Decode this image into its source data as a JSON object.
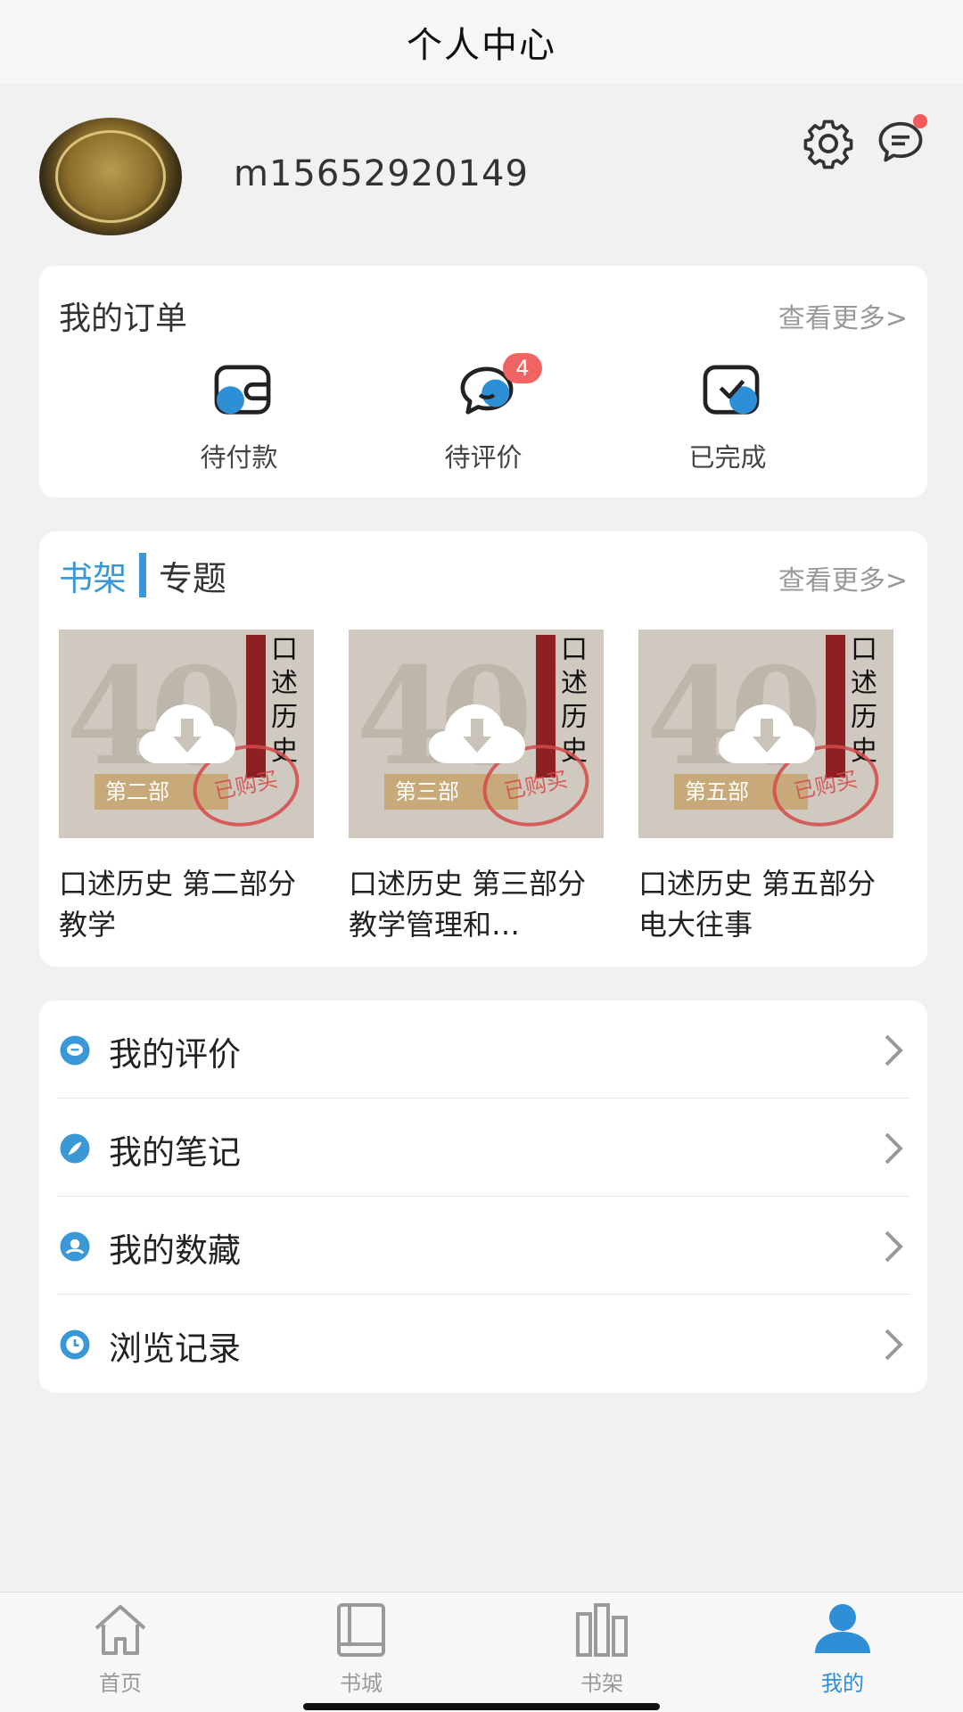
{
  "header": {
    "title": "个人中心"
  },
  "profile": {
    "username": "m15652920149",
    "settings_icon": "gear-icon",
    "messages_icon": "chat-icon"
  },
  "orders": {
    "title": "我的订单",
    "more": "查看更多>",
    "items": [
      {
        "label": "待付款",
        "icon": "wallet-icon"
      },
      {
        "label": "待评价",
        "icon": "comment-icon",
        "badge": "4"
      },
      {
        "label": "已完成",
        "icon": "check-icon"
      }
    ]
  },
  "shelf": {
    "tab_active": "书架",
    "tab_other": "专题",
    "more": "查看更多>",
    "books": [
      {
        "title": "口述历史 第二部分 教学",
        "cover_part": "第二部",
        "cover_title": "口述历史",
        "cover_stamp": "已购买"
      },
      {
        "title": "口述历史 第三部分 教学管理和…",
        "cover_part": "第三部",
        "cover_title": "口述历史",
        "cover_stamp": "已购买"
      },
      {
        "title": "口述历史 第五部分 电大往事",
        "cover_part": "第五部",
        "cover_title": "口述历史",
        "cover_stamp": "已购买"
      }
    ]
  },
  "menu": {
    "items": [
      {
        "label": "我的评价",
        "icon": "comment-circle-icon"
      },
      {
        "label": "我的笔记",
        "icon": "feather-icon"
      },
      {
        "label": "我的数藏",
        "icon": "collection-icon"
      },
      {
        "label": "浏览记录",
        "icon": "clock-icon"
      }
    ]
  },
  "tabbar": {
    "items": [
      {
        "label": "首页",
        "icon": "home-icon"
      },
      {
        "label": "书城",
        "icon": "book-icon"
      },
      {
        "label": "书架",
        "icon": "bookshelf-icon"
      },
      {
        "label": "我的",
        "icon": "user-icon",
        "active": true
      }
    ]
  },
  "colors": {
    "accent": "#3a98d6",
    "badge": "#f06464",
    "background": "#f1f1f1"
  }
}
